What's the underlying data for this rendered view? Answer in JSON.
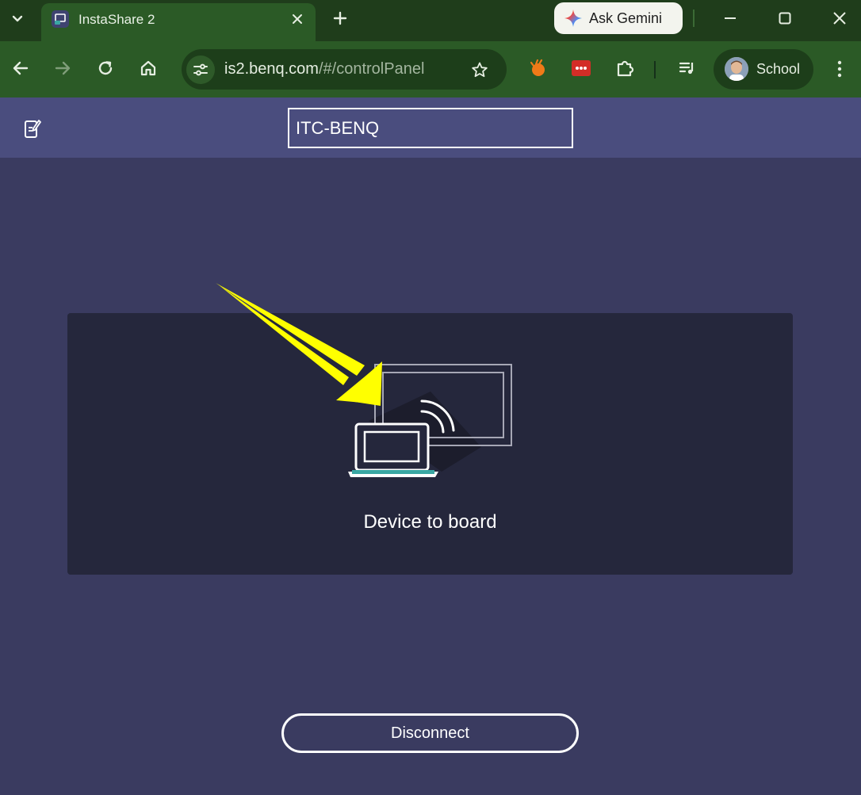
{
  "browser": {
    "tab": {
      "title": "InstaShare 2"
    },
    "gemini": {
      "label": "Ask Gemini"
    },
    "address": {
      "host": "is2.benq.com",
      "path": "/#/controlPanel"
    },
    "profile": {
      "label": "School"
    },
    "icons": {
      "tab_search": "chevron-down-icon",
      "new_tab": "plus-icon",
      "back": "arrow-left-icon",
      "forward": "arrow-right-icon",
      "reload": "reload-icon",
      "home": "home-icon",
      "site_info": "tune-icon",
      "bookmark": "star-icon",
      "extensions": "puzzle-icon",
      "media": "playlist-icon",
      "menu": "kebab-icon"
    },
    "colors": {
      "tabbar": "#1f3d1b",
      "toolbar": "#2b5a26",
      "omnibox": "#1d3e1a"
    }
  },
  "app": {
    "device_name": "ITC-BENQ",
    "mode_card": {
      "label": "Device to board"
    },
    "disconnect_label": "Disconnect",
    "colors": {
      "header": "#4a4d7e",
      "background": "#3a3b60",
      "card": "#25273c",
      "accent": "#3aa7a3",
      "annotation_arrow": "#ffff00"
    }
  }
}
